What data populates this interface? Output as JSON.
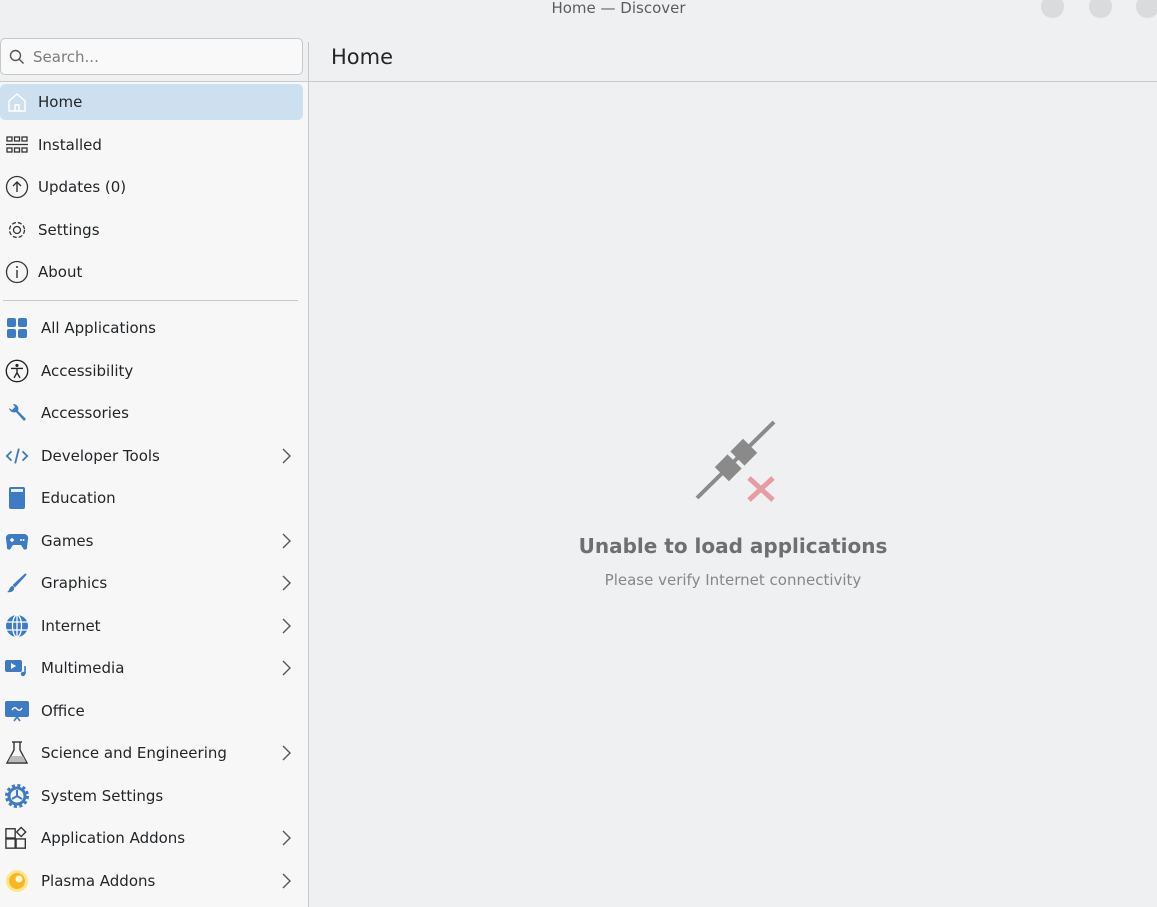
{
  "window": {
    "title": "Home — Discover"
  },
  "search": {
    "placeholder": "Search..."
  },
  "header": {
    "title": "Home"
  },
  "nav": [
    {
      "label": "Home",
      "icon": "home-icon",
      "active": true
    },
    {
      "label": "Installed",
      "icon": "installed-grid-icon"
    },
    {
      "label": "Updates (0)",
      "icon": "update-arrow-icon"
    },
    {
      "label": "Settings",
      "icon": "gear-icon"
    },
    {
      "label": "About",
      "icon": "info-icon"
    }
  ],
  "categories": [
    {
      "label": "All Applications",
      "icon": "all-apps-icon",
      "submenu": false
    },
    {
      "label": "Accessibility",
      "icon": "accessibility-icon",
      "submenu": false
    },
    {
      "label": "Accessories",
      "icon": "wrench-icon",
      "submenu": false
    },
    {
      "label": "Developer Tools",
      "icon": "code-icon",
      "submenu": true
    },
    {
      "label": "Education",
      "icon": "book-icon",
      "submenu": false
    },
    {
      "label": "Games",
      "icon": "gamepad-icon",
      "submenu": true
    },
    {
      "label": "Graphics",
      "icon": "brush-icon",
      "submenu": true
    },
    {
      "label": "Internet",
      "icon": "globe-icon",
      "submenu": true
    },
    {
      "label": "Multimedia",
      "icon": "multimedia-icon",
      "submenu": true
    },
    {
      "label": "Office",
      "icon": "presentation-icon",
      "submenu": false
    },
    {
      "label": "Science and Engineering",
      "icon": "flask-icon",
      "submenu": true
    },
    {
      "label": "System Settings",
      "icon": "system-gear-icon",
      "submenu": false
    },
    {
      "label": "Application Addons",
      "icon": "addons-icon",
      "submenu": true
    },
    {
      "label": "Plasma Addons",
      "icon": "plasma-icon",
      "submenu": true
    }
  ],
  "message": {
    "title": "Unable to load applications",
    "subtitle": "Please verify Internet connectivity",
    "icon": "network-disconnected-icon"
  },
  "colors": {
    "accent": "#3d7cc4",
    "active_bg": "#cde0f0",
    "error": "#e79ba3"
  }
}
